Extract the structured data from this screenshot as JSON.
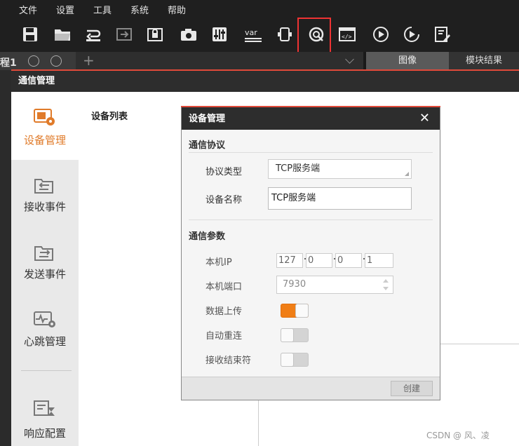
{
  "menu": [
    "文件",
    "设置",
    "工具",
    "系统",
    "帮助"
  ],
  "toolbar_icons": [
    "save-icon",
    "open-folder-icon",
    "import-icon",
    "export-icon",
    "lock-icon",
    "camera-icon",
    "sliders-icon",
    "variable-icon",
    "device-icon",
    "communication-icon",
    "code-script-icon",
    "run-once-icon",
    "run-loop-icon",
    "edit-report-icon"
  ],
  "tabs": {
    "left_label": "程1",
    "image_tab": "图像",
    "result_tab": "模块结果",
    "plus": "+"
  },
  "comm": {
    "title": "通信管理",
    "nav": [
      {
        "label": "设备管理",
        "icon": "device-manage-icon",
        "active": true
      },
      {
        "label": "接收事件",
        "icon": "receive-event-icon",
        "active": false
      },
      {
        "label": "发送事件",
        "icon": "send-event-icon",
        "active": false
      },
      {
        "label": "心跳管理",
        "icon": "heartbeat-icon",
        "active": false
      },
      {
        "label": "响应配置",
        "icon": "response-config-icon",
        "active": false
      }
    ],
    "device_list_title": "设备列表"
  },
  "dialog": {
    "title": "设备管理",
    "close": "✕",
    "protocol_section": "通信协议",
    "protocol_type_label": "协议类型",
    "protocol_type_value": "TCP服务端",
    "device_name_label": "设备名称",
    "device_name_value": "TCP服务端",
    "params_section": "通信参数",
    "local_ip_label": "本机IP",
    "ip": [
      "127",
      "0",
      "0",
      "1"
    ],
    "local_port_label": "本机端口",
    "local_port_value": "7930",
    "data_upload_label": "数据上传",
    "data_upload_on": true,
    "auto_reconnect_label": "自动重连",
    "auto_reconnect_on": false,
    "recv_terminator_label": "接收结束符",
    "recv_terminator_on": false,
    "create_button": "创建"
  },
  "watermark": "CSDN @   风、凌",
  "colors": {
    "accent_orange": "#f07e16",
    "highlight_red": "#e33333",
    "dark_bg": "#1f1f1f"
  }
}
